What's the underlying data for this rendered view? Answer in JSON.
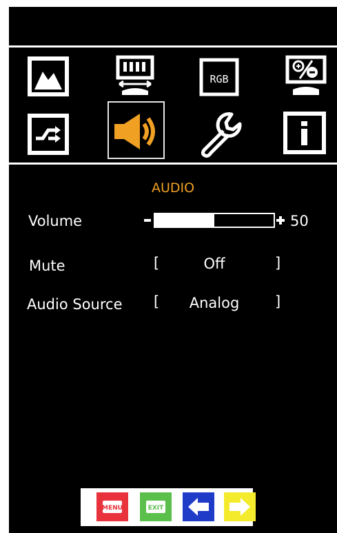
{
  "menu_tabs": [
    {
      "name": "picture",
      "icon": "picture-icon"
    },
    {
      "name": "display",
      "icon": "monitor-position-icon"
    },
    {
      "name": "rgb",
      "icon": "rgb-icon",
      "label": "RGB"
    },
    {
      "name": "color",
      "icon": "monitor-color-icon"
    },
    {
      "name": "input",
      "icon": "input-source-icon"
    },
    {
      "name": "audio",
      "icon": "speaker-icon",
      "selected": true
    },
    {
      "name": "setup",
      "icon": "wrench-icon"
    },
    {
      "name": "info",
      "icon": "info-icon"
    }
  ],
  "panel": {
    "title": "AUDIO",
    "volume": {
      "label": "Volume",
      "value": "50",
      "level": 0.5
    },
    "mute": {
      "label": "Mute",
      "value": "Off",
      "open": "[",
      "close": "]"
    },
    "audio_source": {
      "label": "Audio Source",
      "value": "Analog",
      "open": "[",
      "close": "]"
    }
  },
  "buttons": [
    {
      "name": "menu",
      "label": "MENU",
      "color": "#e8323c"
    },
    {
      "name": "exit",
      "label": "EXIT",
      "color": "#5bbf4c"
    },
    {
      "name": "left",
      "icon": "arrow-left-icon",
      "color": "#1f3cc9"
    },
    {
      "name": "right",
      "icon": "arrow-right-icon",
      "color": "#f5eb2d"
    }
  ],
  "colors": {
    "accent": "#f0a023",
    "background": "#000000",
    "text": "#ffffff"
  }
}
